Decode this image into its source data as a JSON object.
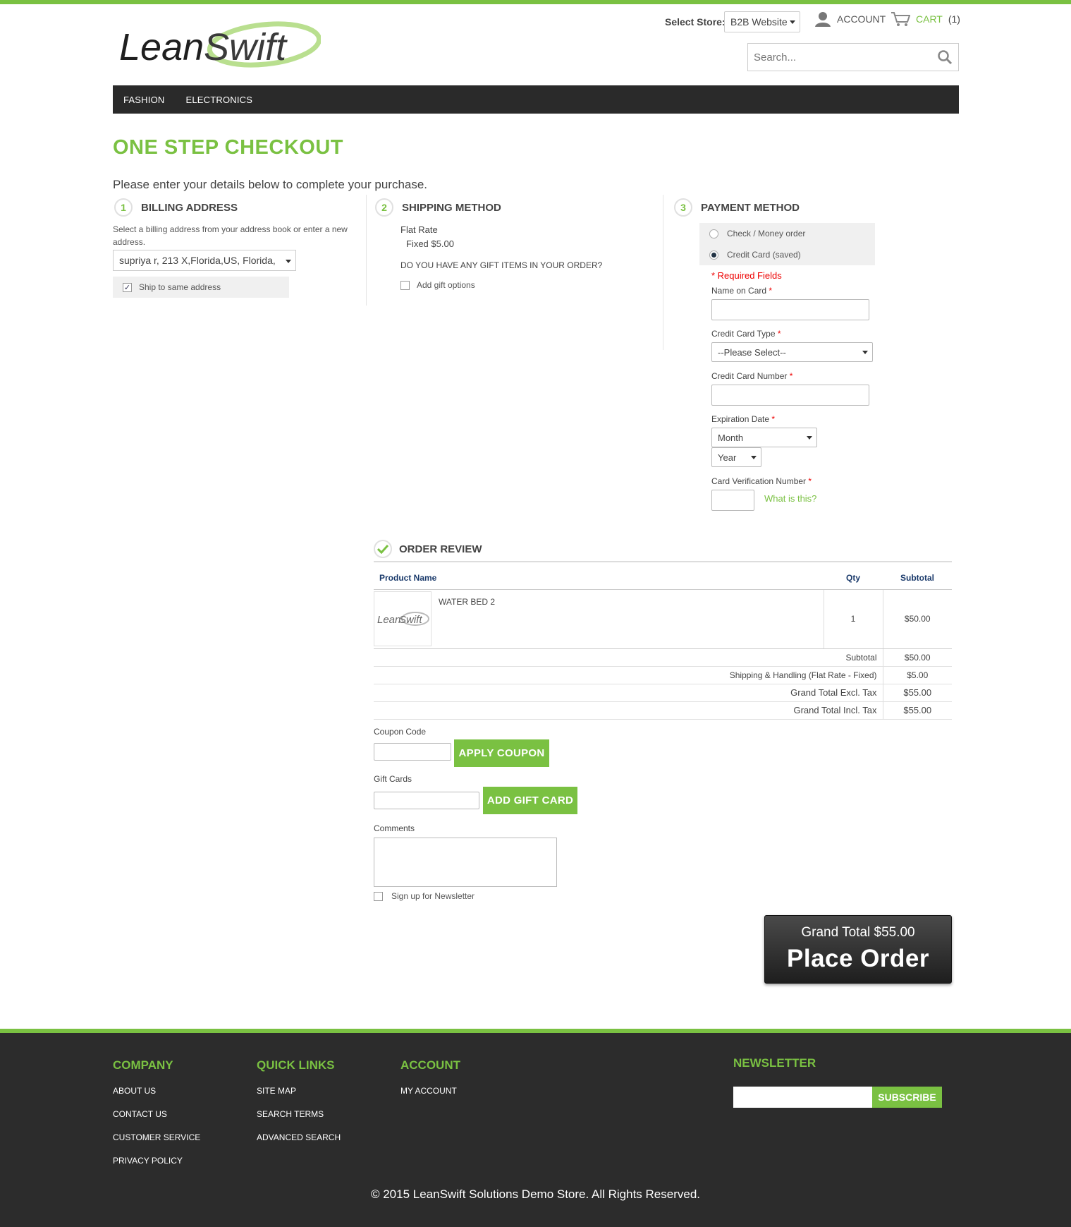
{
  "brand": {
    "logo_text_lean": "Lean",
    "logo_text_swift": "Swift"
  },
  "header": {
    "store_label": "Select Store:",
    "store_value": "B2B Website",
    "account": "ACCOUNT",
    "cart": "CART",
    "cart_count": "(1)",
    "search_placeholder": "Search..."
  },
  "nav": {
    "items": [
      "FASHION",
      "ELECTRONICS"
    ]
  },
  "page": {
    "title": "ONE STEP CHECKOUT",
    "intro": "Please enter your details below to complete your purchase."
  },
  "billing": {
    "num": "1",
    "title": "BILLING ADDRESS",
    "desc": "Select a billing address from your address book or enter a new address.",
    "address_value": "supriya r, 213 X,Florida,US, Florida,",
    "ship_same": "Ship to same address"
  },
  "shipping": {
    "num": "2",
    "title": "SHIPPING METHOD",
    "rate_name": "Flat Rate",
    "rate_price": "Fixed $5.00",
    "gift_question": "DO YOU HAVE ANY GIFT ITEMS IN YOUR ORDER?",
    "gift_option": "Add gift options"
  },
  "payment": {
    "num": "3",
    "title": "PAYMENT METHOD",
    "methods": [
      "Check / Money order",
      "Credit Card (saved)"
    ],
    "selected_method": "Credit Card (saved)",
    "required": "* Required Fields",
    "name_on_card": "Name on Card",
    "cc_type": "Credit Card Type",
    "cc_type_value": "--Please Select--",
    "cc_number": "Credit Card Number",
    "exp_date": "Expiration Date",
    "month": "Month",
    "year": "Year",
    "cvv": "Card Verification Number",
    "what_is_this": "What is this?"
  },
  "review": {
    "title": "ORDER REVIEW",
    "col_product": "Product Name",
    "col_qty": "Qty",
    "col_subtotal": "Subtotal",
    "items": [
      {
        "name": "WATER BED 2",
        "qty": "1",
        "subtotal": "$50.00"
      }
    ],
    "totals": [
      {
        "label": "Subtotal",
        "value": "$50.00"
      },
      {
        "label": "Shipping & Handling (Flat Rate - Fixed)",
        "value": "$5.00"
      },
      {
        "label": "Grand Total Excl. Tax",
        "value": "$55.00"
      },
      {
        "label": "Grand Total Incl. Tax",
        "value": "$55.00"
      }
    ]
  },
  "extras": {
    "coupon_label": "Coupon Code",
    "apply_coupon": "APPLY COUPON",
    "gift_cards_label": "Gift Cards",
    "add_gift_card": "ADD GIFT CARD",
    "comments_label": "Comments",
    "newsletter": "Sign up for Newsletter"
  },
  "place_order": {
    "total": "Grand Total $55.00",
    "label": "Place Order"
  },
  "footer": {
    "company": {
      "title": "COMPANY",
      "links": [
        "ABOUT US",
        "CONTACT US",
        "CUSTOMER SERVICE",
        "PRIVACY POLICY"
      ]
    },
    "quick_links": {
      "title": "QUICK LINKS",
      "links": [
        "SITE MAP",
        "SEARCH TERMS",
        "ADVANCED SEARCH"
      ]
    },
    "account": {
      "title": "ACCOUNT",
      "links": [
        "MY ACCOUNT"
      ]
    },
    "newsletter": {
      "title": "NEWSLETTER",
      "subscribe": "SUBSCRIBE"
    },
    "copyright": "© 2015 LeanSwift Solutions Demo Store. All Rights Reserved."
  },
  "colors": {
    "accent": "#7ac142",
    "nav_bg": "#2a2a2a",
    "footer_bg": "#2c2c2c"
  }
}
